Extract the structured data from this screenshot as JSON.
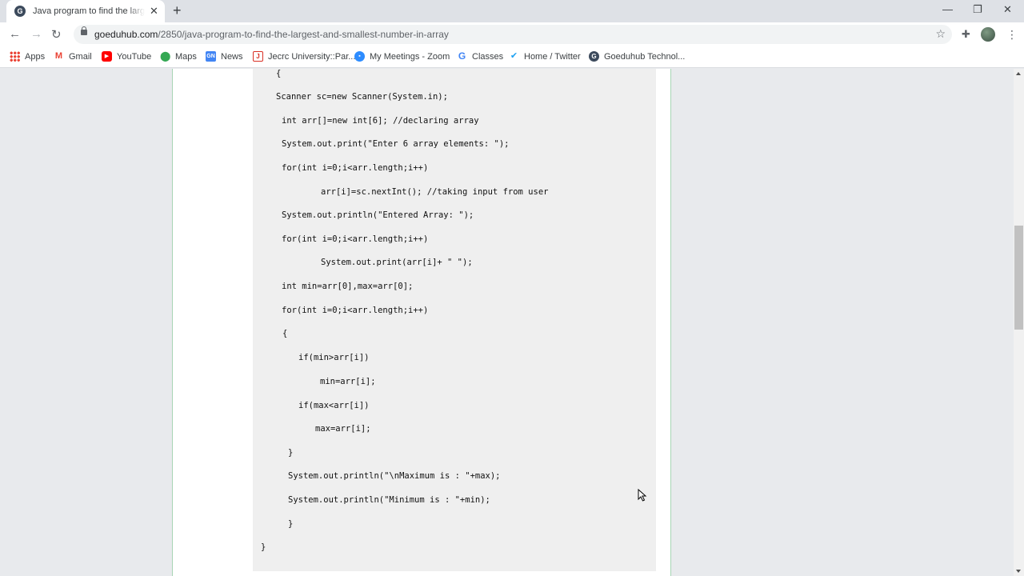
{
  "tab": {
    "title": "Java program to find the largest and smallest number in array",
    "favicon": "G"
  },
  "url": {
    "host": "goeduhub.com",
    "path": "/2850/java-program-to-find-the-largest-and-smallest-number-in-array"
  },
  "bookmarks": [
    {
      "label": "Apps",
      "icon": "apps-grid-icon"
    },
    {
      "label": "Gmail",
      "icon": "gmail-icon"
    },
    {
      "label": "YouTube",
      "icon": "youtube-icon"
    },
    {
      "label": "Maps",
      "icon": "maps-icon"
    },
    {
      "label": "News",
      "icon": "news-icon"
    },
    {
      "label": "Jecrc University::Par...",
      "icon": "jecrc-icon"
    },
    {
      "label": "My Meetings - Zoom",
      "icon": "zoom-icon"
    },
    {
      "label": "Classes",
      "icon": "google-icon"
    },
    {
      "label": "Home / Twitter",
      "icon": "twitter-icon"
    },
    {
      "label": "Goeduhub Technol...",
      "icon": "goeduhub-icon"
    }
  ],
  "code": [
    "{",
    "Scanner sc=new Scanner(System.in);",
    "int arr[]=new int[6]; //declaring array",
    "System.out.print(\"Enter 6 array elements: \");",
    "for(int i=0;i<arr.length;i++)",
    "arr[i]=sc.nextInt(); //taking input from user",
    "System.out.println(\"Entered Array: \");",
    "for(int i=0;i<arr.length;i++)",
    "System.out.print(arr[i]+ \" \");",
    "int min=arr[0],max=arr[0];",
    "for(int i=0;i<arr.length;i++)",
    "{",
    "if(min>arr[i])",
    "min=arr[i];",
    "if(max<arr[i])",
    "max=arr[i];",
    "}",
    "System.out.println(\"\\nMaximum is : \"+max);",
    "System.out.println(\"Minimum is : \"+min);",
    "}",
    "}"
  ],
  "colors": {
    "accent_green": "#a8d5b5",
    "code_bg": "#efefef",
    "page_bg": "#e8eaed"
  }
}
